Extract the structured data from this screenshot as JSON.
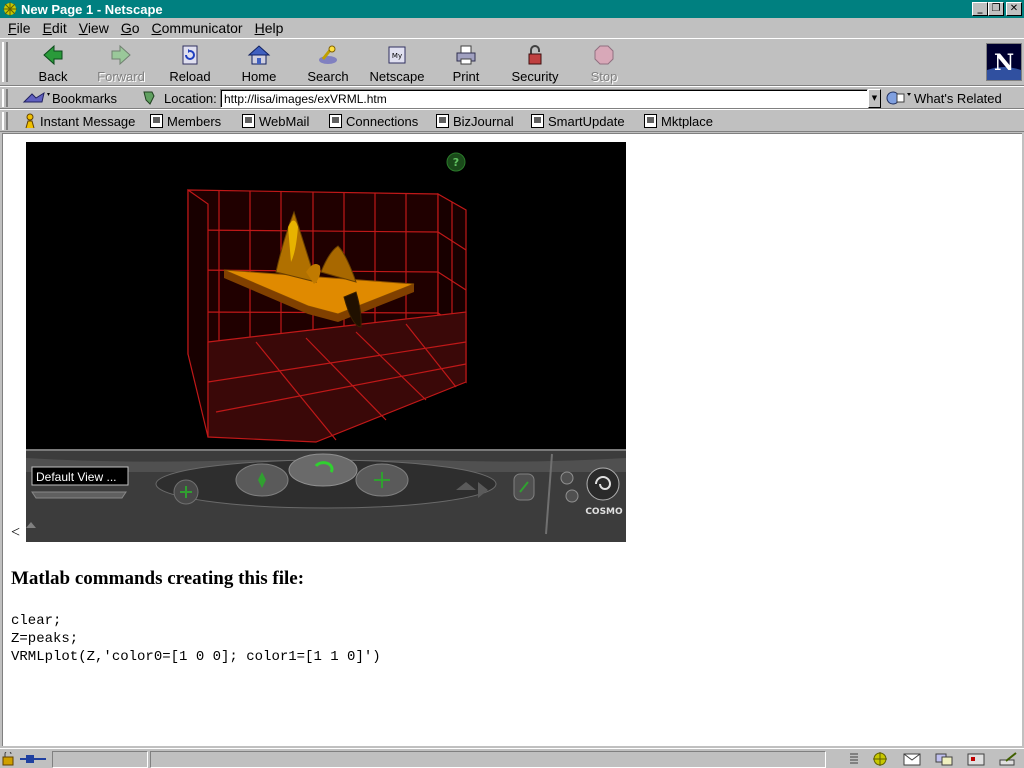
{
  "window": {
    "title": "New Page 1 - Netscape"
  },
  "menu": [
    "File",
    "Edit",
    "View",
    "Go",
    "Communicator",
    "Help"
  ],
  "navigation": {
    "back": "Back",
    "forward": "Forward",
    "reload": "Reload",
    "home": "Home",
    "search": "Search",
    "netscape": "Netscape",
    "print": "Print",
    "security": "Security",
    "stop": "Stop"
  },
  "location_bar": {
    "bookmarks": "Bookmarks",
    "label": "Location:",
    "url": "http://lisa/images/exVRML.htm",
    "related": "What's Related"
  },
  "personal_toolbar": [
    "Instant Message",
    "Members",
    "WebMail",
    "Connections",
    "BizJournal",
    "SmartUpdate",
    "Mktplace"
  ],
  "page": {
    "stray_char": "<",
    "vrml_viewer": {
      "view_label": "Default View ...",
      "brand": "COSMO",
      "help_glyph": "?"
    },
    "heading": "Matlab commands creating this file:",
    "code_lines": [
      "clear;",
      "Z=peaks;",
      "VRMLplot(Z,'color0=[1 0 0]; color1=[1 1 0]')"
    ]
  },
  "colors": {
    "titlebar": "#008080",
    "chrome": "#c0c0c0",
    "grid": "#ff2020",
    "surface": "#e08a00"
  }
}
